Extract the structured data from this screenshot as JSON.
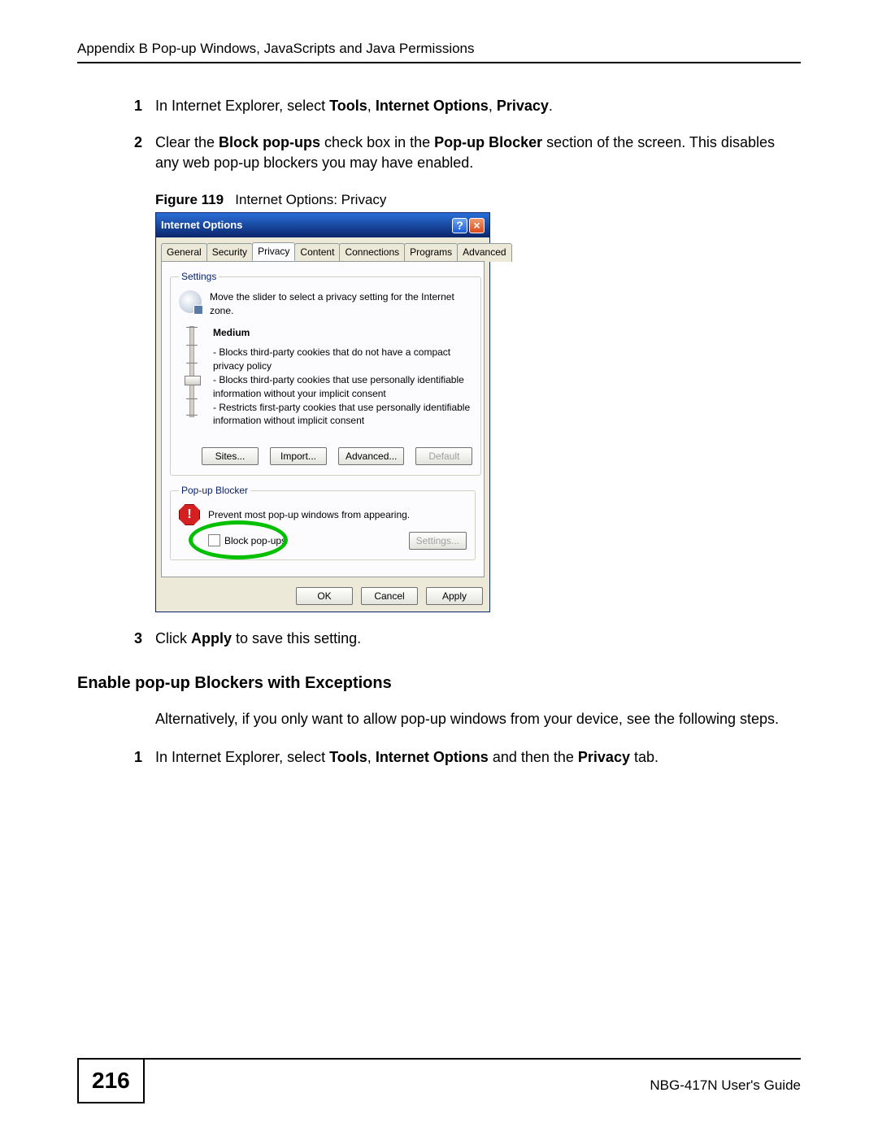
{
  "header": {
    "appendix": "Appendix B Pop-up Windows, JavaScripts and Java Permissions"
  },
  "steps1": [
    {
      "num": "1",
      "pre": "In Internet Explorer, select ",
      "b1": "Tools",
      "mid1": ", ",
      "b2": "Internet Options",
      "mid2": ", ",
      "b3": "Privacy",
      "post": "."
    },
    {
      "num": "2",
      "pre": "Clear the ",
      "b1": "Block pop-ups",
      "mid1": " check box in the ",
      "b2": "Pop-up Blocker",
      "post": " section of the screen. This disables any web pop-up blockers you may have enabled."
    }
  ],
  "figure": {
    "label": "Figure 119",
    "caption": "Internet Options: Privacy"
  },
  "dialog": {
    "title": "Internet Options",
    "tabs": [
      "General",
      "Security",
      "Privacy",
      "Content",
      "Connections",
      "Programs",
      "Advanced"
    ],
    "activeTab": 2,
    "settings": {
      "legend": "Settings",
      "intro": "Move the slider to select a privacy setting for the Internet zone.",
      "level": "Medium",
      "desc": "- Blocks third-party cookies that do not have a compact privacy policy\n- Blocks third-party cookies that use personally identifiable information without your implicit consent\n- Restricts first-party cookies that use personally identifiable information without implicit consent",
      "buttons": {
        "sites": "Sites...",
        "import": "Import...",
        "advanced": "Advanced...",
        "default": "Default"
      }
    },
    "popup": {
      "legend": "Pop-up Blocker",
      "intro": "Prevent most pop-up windows from appearing.",
      "checkbox": "Block pop-ups",
      "settings": "Settings..."
    },
    "buttons": {
      "ok": "OK",
      "cancel": "Cancel",
      "apply": "Apply"
    }
  },
  "step3": {
    "num": "3",
    "pre": "Click ",
    "b1": "Apply",
    "post": " to save this setting."
  },
  "section": {
    "heading": "Enable pop-up Blockers with Exceptions",
    "para": "Alternatively, if you only want to allow pop-up windows from your device, see the following steps."
  },
  "steps2": [
    {
      "num": "1",
      "pre": "In Internet Explorer, select ",
      "b1": "Tools",
      "mid1": ", ",
      "b2": "Internet Options",
      "mid2": " and then the ",
      "b3": "Privacy",
      "post": " tab."
    }
  ],
  "footer": {
    "page": "216",
    "guide": "NBG-417N User's Guide"
  }
}
